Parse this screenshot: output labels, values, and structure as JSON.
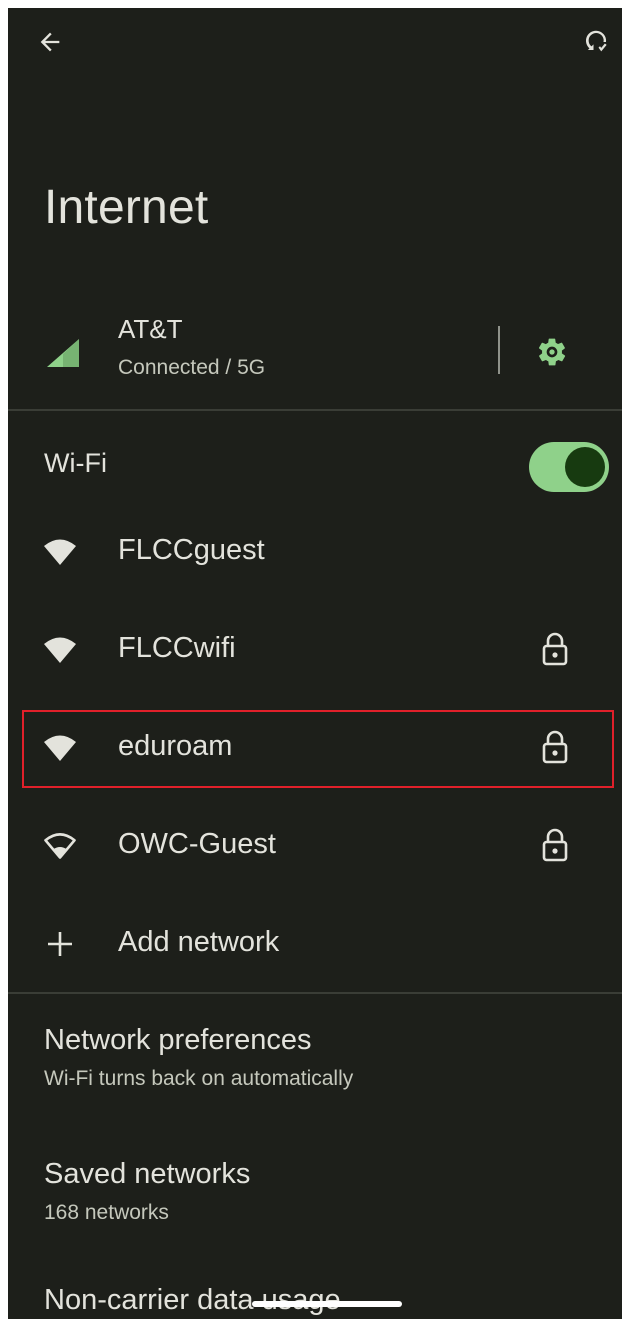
{
  "header": {
    "back_icon": "arrow-back-icon",
    "reset_icon": "network-reset-icon"
  },
  "title": "Internet",
  "carrier": {
    "name": "AT&T",
    "status": "Connected / 5G",
    "signal_icon": "cell-signal-icon",
    "settings_icon": "gear-icon"
  },
  "wifi": {
    "label": "Wi-Fi",
    "enabled": true
  },
  "networks": [
    {
      "name": "FLCCguest",
      "secured": false,
      "signal": "full"
    },
    {
      "name": "FLCCwifi",
      "secured": true,
      "signal": "full"
    },
    {
      "name": "eduroam",
      "secured": true,
      "signal": "full"
    },
    {
      "name": "OWC-Guest",
      "secured": true,
      "signal": "outline"
    }
  ],
  "add_network": {
    "label": "Add network",
    "icon": "plus-icon"
  },
  "preferences": [
    {
      "title": "Network preferences",
      "subtitle": "Wi-Fi turns back on automatically"
    },
    {
      "title": "Saved networks",
      "subtitle": "168 networks"
    },
    {
      "title": "Non-carrier data usage",
      "subtitle": ""
    }
  ],
  "colors": {
    "background": "#1d1f1a",
    "accent": "#8fd18a",
    "highlight_border": "#e0202a"
  }
}
